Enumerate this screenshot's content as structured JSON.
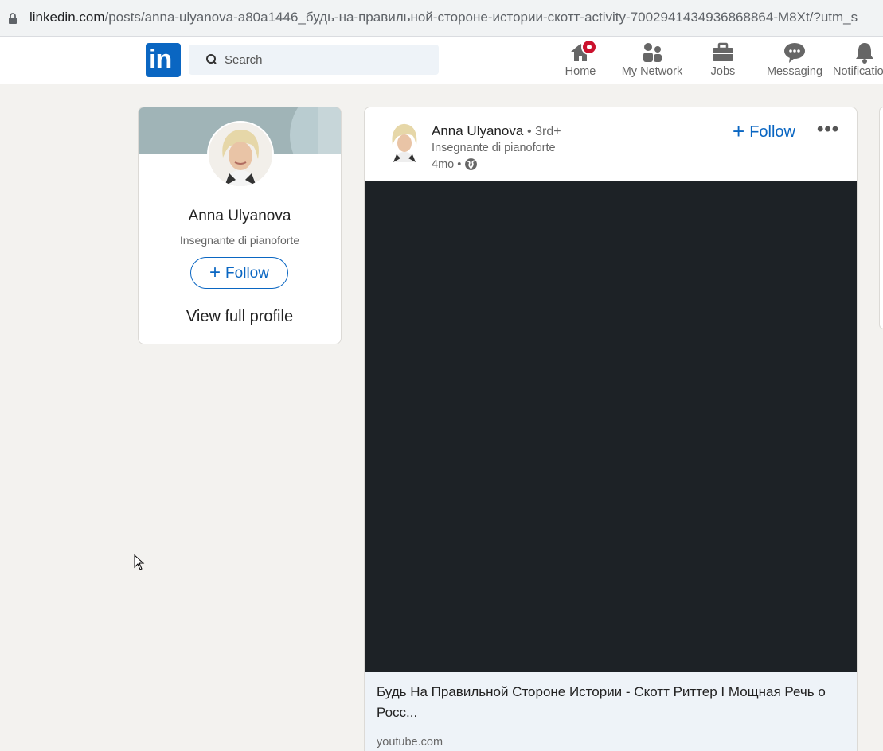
{
  "browser": {
    "url_host": "linkedin.com",
    "url_path": "/posts/anna-ulyanova-a80a1446_будь-на-правильной-стороне-истории-скотт-activity-7002941434936868864-M8Xt/?utm_s"
  },
  "nav": {
    "logo_text": "in",
    "search_placeholder": "Search",
    "items": [
      {
        "label": "Home",
        "icon": "home-icon"
      },
      {
        "label": "My Network",
        "icon": "network-icon"
      },
      {
        "label": "Jobs",
        "icon": "briefcase-icon"
      },
      {
        "label": "Messaging",
        "icon": "messaging-icon"
      },
      {
        "label": "Notifications",
        "icon": "bell-icon"
      }
    ]
  },
  "profile_card": {
    "name": "Anna Ulyanova",
    "headline": "Insegnante di pianoforte",
    "follow_label": "Follow",
    "view_profile_label": "View full profile"
  },
  "post": {
    "author_name": "Anna Ulyanova",
    "degree": "• 3rd+",
    "headline": "Insegnante di pianoforte",
    "time": "4mo •",
    "follow_label": "Follow",
    "more_label": "•••",
    "link_title": "Будь На Правильной Стороне Истории - Скотт Риттер I Мощная Речь о Росс...",
    "link_source": "youtube.com"
  },
  "colors": {
    "brand": "#0a66c2",
    "badge": "#cb112d",
    "background": "#f3f2ef",
    "video": "#1d2226"
  }
}
